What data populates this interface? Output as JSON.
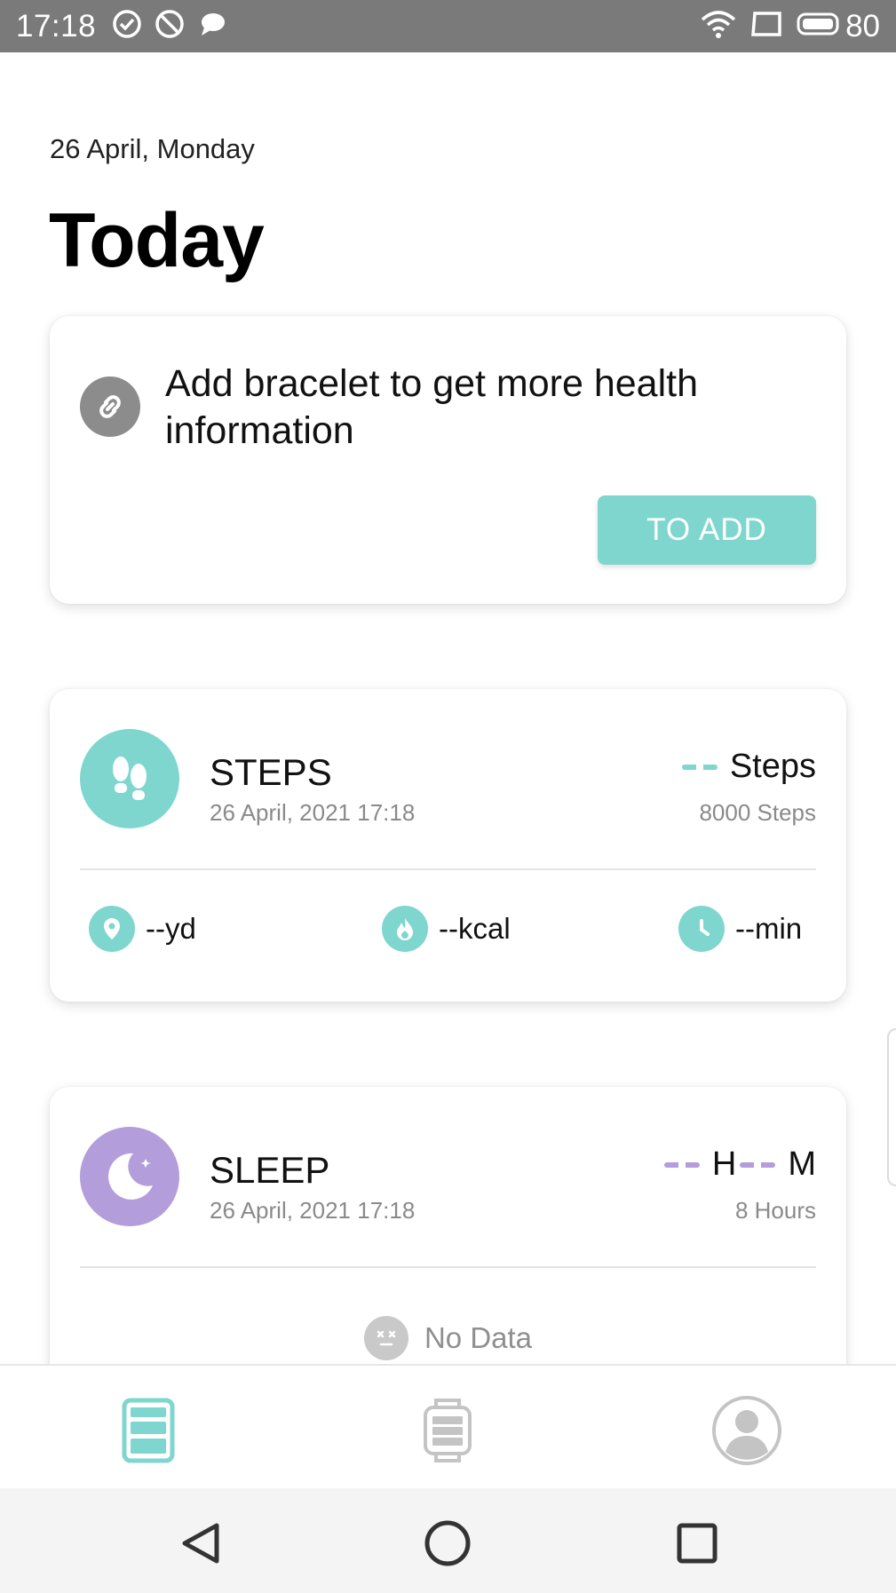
{
  "status_bar": {
    "time": "17:18",
    "battery": "80",
    "left_icons": [
      "check-circle-icon",
      "block-icon",
      "chat-bubble-icon"
    ],
    "right_icons": [
      "wifi-icon",
      "cast-icon",
      "battery-icon"
    ]
  },
  "header": {
    "date": "26 April, Monday",
    "title": "Today"
  },
  "bracelet_card": {
    "icon": "link-icon",
    "message": "Add bracelet to get more health information",
    "button_label": "TO ADD"
  },
  "steps_card": {
    "icon": "footprints-icon",
    "title": "STEPS",
    "timestamp": "26 April, 2021 17:18",
    "value_unit": "Steps",
    "goal": "8000 Steps",
    "stats": [
      {
        "icon": "location-pin-icon",
        "value": "--yd"
      },
      {
        "icon": "flame-icon",
        "value": "--kcal"
      },
      {
        "icon": "clock-icon",
        "value": "--min"
      }
    ]
  },
  "sleep_card": {
    "icon": "moon-stars-icon",
    "title": "SLEEP",
    "timestamp": "26 April, 2021 17:18",
    "hours_unit": "H",
    "minutes_unit": "M",
    "goal": "8 Hours",
    "empty_state": "No Data"
  },
  "tab_bar": {
    "tabs": [
      {
        "name": "dashboard",
        "icon": "dashboard-icon",
        "active": true
      },
      {
        "name": "device",
        "icon": "watch-icon",
        "active": false
      },
      {
        "name": "profile",
        "icon": "profile-icon",
        "active": false
      }
    ]
  },
  "nav_bar": {
    "buttons": [
      "back-icon",
      "home-icon",
      "recents-icon"
    ]
  },
  "colors": {
    "accent_teal": "#7fd6cf",
    "sleep_purple": "#b39ddb",
    "status_bar": "#7a7a7a"
  }
}
